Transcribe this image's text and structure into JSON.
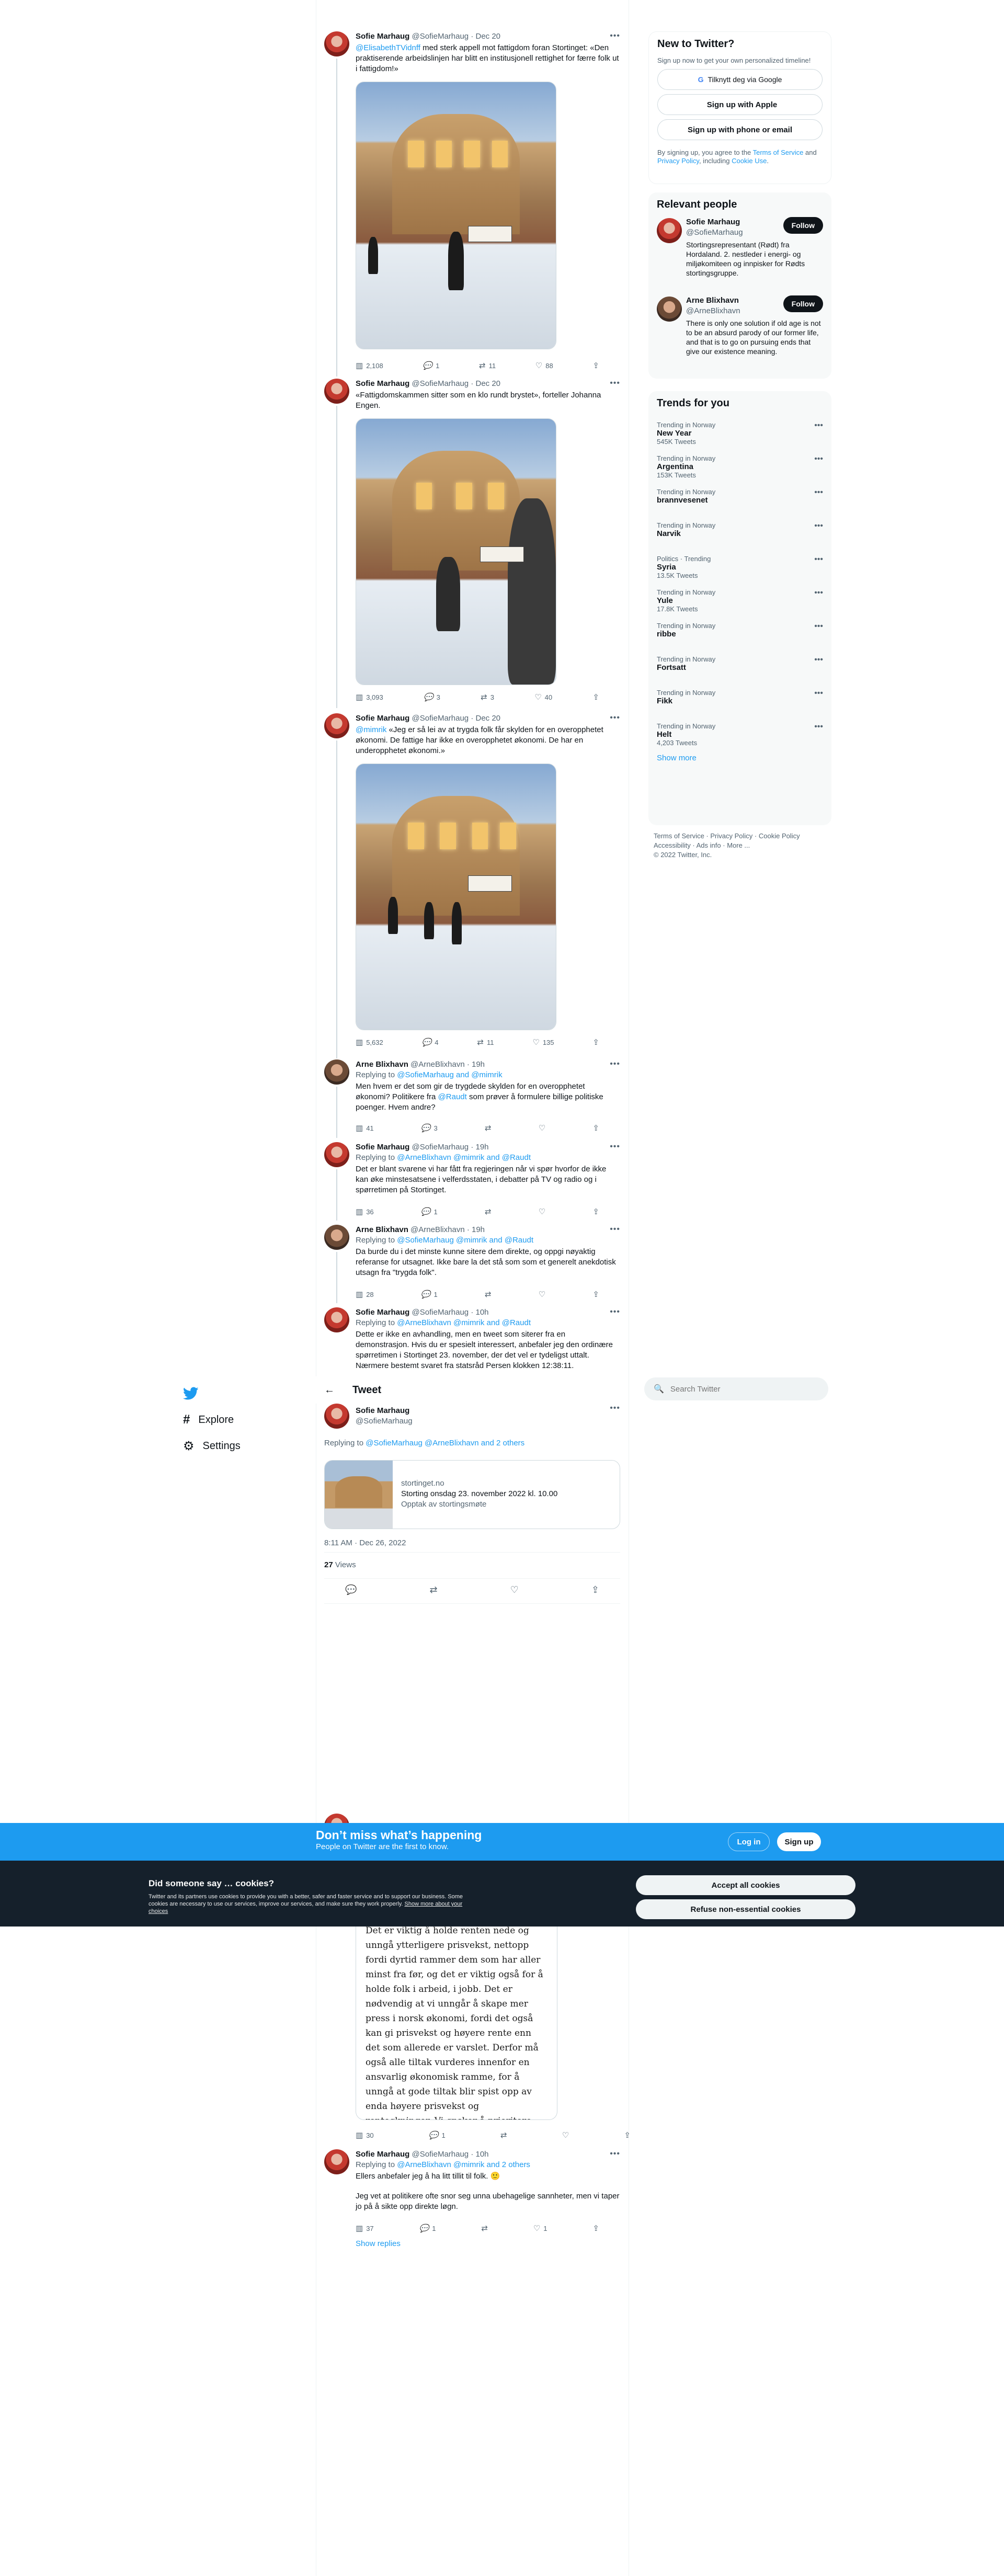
{
  "nav": {
    "explore": "Explore",
    "settings": "Settings"
  },
  "header": {
    "title": "Tweet"
  },
  "tweets": [
    {
      "name": "Sofie Marhaug",
      "handle": "@SofieMarhaug",
      "date": "· Dec 20",
      "mentions": "@ElisabethTVidnff",
      "text": " med sterk appell mot fattigdom foran Stortinget: «Den praktiserende arbeidslinjen har blitt en institusjonell rettighet for færre folk ut i fattigdom!»",
      "views": "2,108",
      "replies": "1",
      "retweets": "11",
      "likes": "88"
    },
    {
      "name": "Sofie Marhaug",
      "handle": "@SofieMarhaug",
      "date": "· Dec 20",
      "text": "«Fattigdomskammen sitter som en klo rundt brystet», forteller Johanna Engen.",
      "views": "3,093",
      "replies": "3",
      "retweets": "3",
      "likes": "40"
    },
    {
      "name": "Sofie Marhaug",
      "handle": "@SofieMarhaug",
      "date": "· Dec 20",
      "mentions": "@mimrik",
      "text": " «Jeg er så lei av at trygda folk får skylden for en overopphetet økonomi. De fattige har ikke en overopphetet økonomi. De har en underopphetet økonomi.»",
      "views": "5,632",
      "replies": "4",
      "retweets": "11",
      "likes": "135"
    },
    {
      "name": "Arne Blixhavn",
      "handle": "@ArneBlixhavn",
      "date": "· 19h",
      "reply_prefix": "Replying to ",
      "reply_users": "@SofieMarhaug and @mimrik",
      "text": "Men hvem er det som gir de trygdede skylden for en overopphetet økonomi? Politikere fra ",
      "text_link": "@Raudt",
      "text_after": " som prøver å formulere billige politiske poenger. Hvem andre?",
      "views": "41",
      "replies": "3",
      "retweets": "",
      "likes": ""
    },
    {
      "name": "Sofie Marhaug",
      "handle": "@SofieMarhaug",
      "date": "· 19h",
      "reply_prefix": "Replying to ",
      "reply_users": "@ArneBlixhavn @mimrik and @Raudt",
      "text": "Det er blant svarene vi har fått fra regjeringen når vi spør hvorfor de ikke kan øke minstesatsene i velferdsstaten, i debatter på TV og radio og i spørretimen på Stortinget.",
      "views": "36",
      "replies": "1",
      "retweets": "",
      "likes": ""
    },
    {
      "name": "Arne Blixhavn",
      "handle": "@ArneBlixhavn",
      "date": "· 19h",
      "reply_prefix": "Replying to ",
      "reply_users": "@SofieMarhaug @mimrik and @Raudt",
      "text": "Da burde du i det minste kunne sitere dem direkte, og oppgi nøyaktig referanse for utsagnet. Ikke bare la det stå som som et generelt anekdotisk utsagn fra \"trygda folk\".",
      "views": "28",
      "replies": "1",
      "retweets": "",
      "likes": ""
    },
    {
      "name": "Sofie Marhaug",
      "handle": "@SofieMarhaug",
      "date": "· 10h",
      "reply_prefix": "Replying to ",
      "reply_users": "@ArneBlixhavn @mimrik and @Raudt",
      "text": "Dette er ikke en avhandling, men en tweet som siterer fra en demonstrasjon. Hvis du er spesielt interessert, anbefaler jeg den ordinære spørretimen i Stortinget 23. november, der det vel er tydeligst uttalt. Nærmere bestemt svaret fra statsråd Persen klokken 12:38:11."
    }
  ],
  "main_tweet": {
    "name": "Sofie Marhaug",
    "handle": "@SofieMarhaug",
    "reply_prefix": "Replying to ",
    "reply_users": "@SofieMarhaug @ArneBlixhavn and 2 others",
    "card_domain": "stortinget.no",
    "card_title": "Storting onsdag 23. november 2022 kl. 10.00",
    "card_desc": "Opptak av stortingsmøte",
    "timestamp": "8:11 AM · Dec 26, 2022",
    "views_count": "27",
    "views_label": " Views"
  },
  "lower_tweets": [
    {
      "views": "30",
      "replies": "1",
      "retweets": "",
      "likes": ""
    },
    {
      "name": "Sofie Marhaug",
      "handle": "@SofieMarhaug",
      "date": "· 10h",
      "reply_prefix": "Replying to ",
      "reply_users": "@ArneBlixhavn @mimrik and 2 others",
      "text": "Ellers anbefaler jeg å ha litt tillit til folk. 🙂",
      "text2": "Jeg vet at politikere ofte snor seg unna ubehagelige sannheter, men vi taper jo på å sikte opp direkte løgn.",
      "views": "37",
      "replies": "1",
      "retweets": "",
      "likes": "1"
    }
  ],
  "image_text": "Det er viktig å holde renten nede og unngå ytterligere prisvekst, nettopp fordi dyrtid rammer dem som har aller minst fra før, og det er viktig også for å holde folk i arbeid, i jobb. Det er nødvendig at vi unngår å skape mer press i norsk økonomi, fordi det også kan gi prisvekst og høyere rente enn det som allerede er varslet. Derfor må også alle tiltak vurderes innenfor en ansvarlig økonomisk ramme, for å unngå at gode tiltak blir spist opp av enda høyere prisvekst og renteøkninger. Vi ønsker å prioritere bl.a. barnehage og barnetrygd for",
  "show_replies": "Show replies",
  "search": {
    "placeholder": "Search Twitter"
  },
  "new_to_twitter": {
    "title": "New to Twitter?",
    "subtitle": "Sign up now to get your own personalized timeline!",
    "google": "Tilknytt deg via Google",
    "apple": "Sign up with Apple",
    "phone": "Sign up with phone or email",
    "terms_a": "By signing up, you agree to the ",
    "terms_link1": "Terms of Service",
    "terms_b": " and ",
    "terms_link2": "Privacy Policy",
    "terms_c": ", including ",
    "terms_link3": "Cookie Use",
    "terms_d": "."
  },
  "relevant": {
    "title": "Relevant people",
    "people": [
      {
        "name": "Sofie Marhaug",
        "handle": "@SofieMarhaug",
        "follow": "Follow",
        "bio": "Stortingsrepresentant (Rødt) fra Hordaland. 2. nestleder i energi- og miljøkomiteen og innpisker for Rødts stortingsgruppe."
      },
      {
        "name": "Arne Blixhavn",
        "handle": "@ArneBlixhavn",
        "follow": "Follow",
        "bio": "There is only one solution if old age is not to be an absurd parody of our former life, and that is to go on pursuing ends that give our existence meaning."
      }
    ]
  },
  "trends": {
    "title": "Trends for you",
    "show_more": "Show more",
    "items": [
      {
        "cat": "Trending in Norway",
        "name": "New Year",
        "count": "545K Tweets"
      },
      {
        "cat": "Trending in Norway",
        "name": "Argentina",
        "count": "153K Tweets"
      },
      {
        "cat": "Trending in Norway",
        "name": "brannvesenet",
        "count": ""
      },
      {
        "cat": "Trending in Norway",
        "name": "Narvik",
        "count": ""
      },
      {
        "cat": "Politics · Trending",
        "name": "Syria",
        "count": "13.5K Tweets"
      },
      {
        "cat": "Trending in Norway",
        "name": "Yule",
        "count": "17.8K Tweets"
      },
      {
        "cat": "Trending in Norway",
        "name": "ribbe",
        "count": ""
      },
      {
        "cat": "Trending in Norway",
        "name": "Fortsatt",
        "count": ""
      },
      {
        "cat": "Trending in Norway",
        "name": "Fikk",
        "count": ""
      },
      {
        "cat": "Trending in Norway",
        "name": "Helt",
        "count": "4,203 Tweets"
      }
    ]
  },
  "footer": {
    "l1": "Terms of Service",
    "l2": "Privacy Policy",
    "l3": "Cookie Policy",
    "l4": "Accessibility",
    "l5": "Ads info",
    "l6": "More ...",
    "copy": "© 2022 Twitter, Inc."
  },
  "bottom_banner": {
    "title": "Don’t miss what’s happening",
    "subtitle": "People on Twitter are the first to know.",
    "login": "Log in",
    "signup": "Sign up"
  },
  "cookie": {
    "title": "Did someone say … cookies?",
    "text": "Twitter and its partners use cookies to provide you with a better, safer and faster service and to support our business. Some cookies are necessary to use our services, improve our services, and make sure they work properly. ",
    "link": "Show more about your choices",
    "accept": "Accept all cookies",
    "refuse": "Refuse non-essential cookies"
  },
  "colors": {
    "accent": "#1d9bf0",
    "text": "#0f1419",
    "muted": "#536471",
    "dark": "#15202b"
  }
}
